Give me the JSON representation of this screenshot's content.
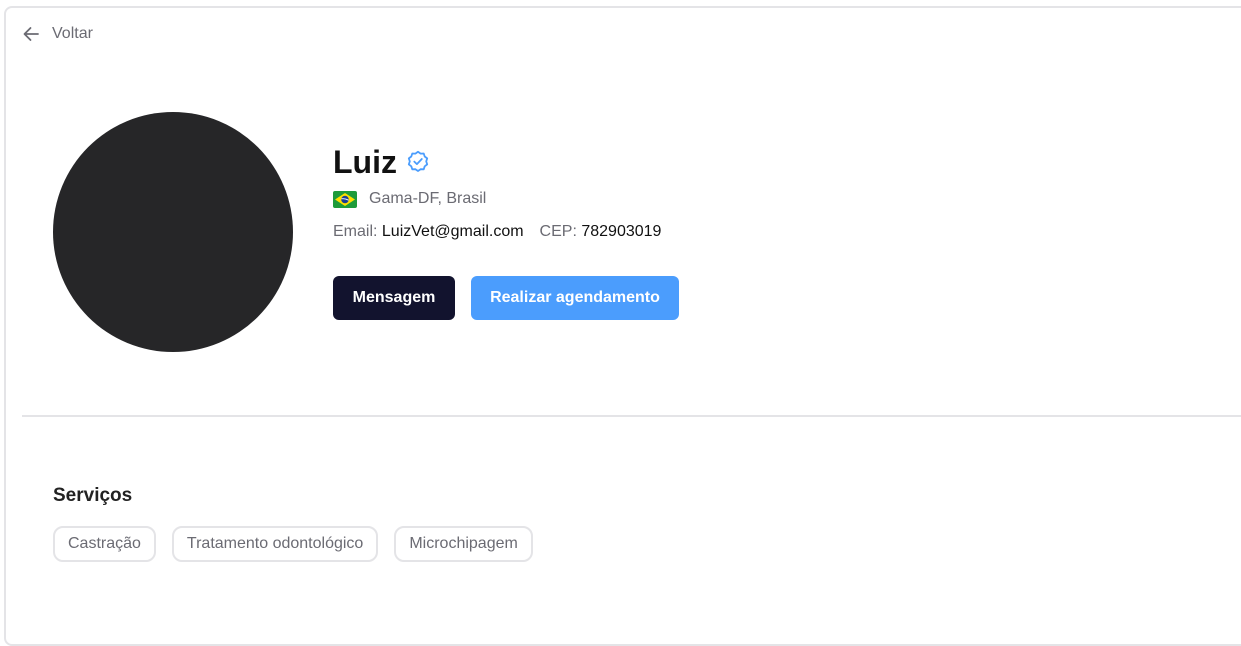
{
  "nav": {
    "back_label": "Voltar"
  },
  "profile": {
    "name": "Luiz",
    "location": "Gama-DF, Brasil",
    "email_label": "Email:",
    "email": "LuizVet@gmail.com",
    "cep_label": "CEP:",
    "cep": "782903019",
    "avatar_color": "#262628",
    "verified_color": "#4b9dfd"
  },
  "actions": {
    "message_label": "Mensagem",
    "schedule_label": "Realizar agendamento",
    "message_color": "#12132e",
    "schedule_color": "#4b9dfd"
  },
  "services": {
    "title": "Serviços",
    "items": [
      "Castração",
      "Tratamento odontológico",
      "Microchipagem"
    ]
  },
  "icons": {
    "back": "arrow-left-icon",
    "verified": "verified-badge-icon",
    "flag": "brazil-flag-icon"
  }
}
